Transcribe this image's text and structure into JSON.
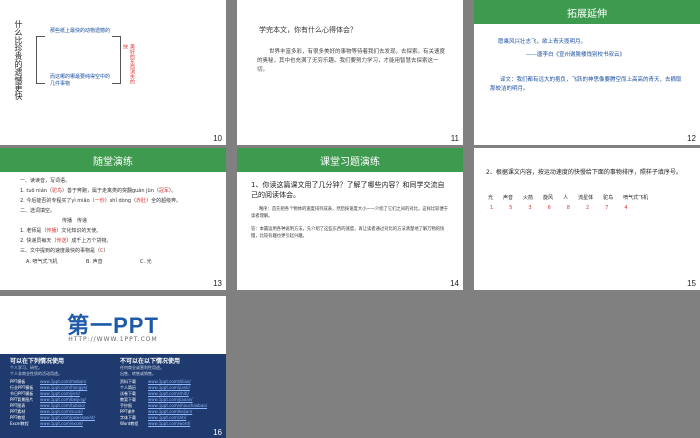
{
  "slides": {
    "s10": {
      "number": "10",
      "title": "什么比珍贵的遗憾更快",
      "branch1": "那些纸上最快的动物遗憾的",
      "branch2": "而这哪的哪最要纯得空中的几件事物",
      "side": "美好的东西消失的快"
    },
    "s11": {
      "number": "11",
      "title": "学完本文，你有什么心得体会？",
      "para": "世界丰富多彩，有很多美好的事物等待着我们去发现，去探索。有关速度的奥秘，其中也充满了无穷乐趣。我们要努力学习，才能用智慧去探索这一切。"
    },
    "s12": {
      "number": "12",
      "header": "拓展延伸",
      "quote1": "愿乘风兴壮志飞，欲上青天揽明月。",
      "quote2": "——唐李白《宣州谢朓楼饯别校书叔云》",
      "para": "译文：我们都有远大的抱负，飞跃的神思像要腾空而上高高的青天，去摘取那皎洁的明月。"
    },
    "s13": {
      "number": "13",
      "header": "随堂演练",
      "q1": "一、读读音，写词语。",
      "l1a": "1. tuō nián（",
      "l1b": "驼鸟",
      "l1c": "）善于奔跑，属于走禽类的",
      "l1d": "突翻guàn jūn（",
      "l1e": "冠军",
      "l1f": "）。",
      "l2a": "2. 今后能否的专程买了yì miǎo（",
      "l2b": "一秒",
      "l2c": "）shǐ dòng（",
      "l2d": "赤肚",
      "l2e": "）全的超级奔。",
      "q2": "二、选词填空。",
      "choices": "传播　传递",
      "s1a": "1. 老师是（",
      "s1b": "传播",
      "s1c": "）文化知识的天使。",
      "s2a": "2. 快递员每天（",
      "s2b": "传送",
      "s2c": "）成千上万个货物。",
      "q3a": "三、文中提到的速度最快的事物是（",
      "q3b": "C",
      "q3c": "）",
      "optA": "A. 喷气式飞机",
      "optB": "B. 声音",
      "optC": "C. 光"
    },
    "s14": {
      "number": "14",
      "header": "课堂习题演练",
      "question": "1、你读这篇课文用了几分钟？了解了哪些内容？和同学交流自己的阅读体会。",
      "para1": "略序：首先把各个物体的速度排列成表，然后按速度大小一一介绍了它们之间的对比，这样比较便于读者理解。",
      "para2": "答：本篇运用各种说明方法，先介绍了这些东西的速度，再让读者通过对比的方法清楚地了解万物的快慢，比较有趣也更引起兴趣。"
    },
    "s15": {
      "number": "15",
      "question": "2、根据课文内容，按运动速度的快慢给下面的事物排序，照样子填序号。",
      "items": [
        "光",
        "声音",
        "火箭",
        "旋风",
        "人",
        "流星体",
        "驼鸟",
        "喷气式飞机"
      ],
      "orders": [
        "1",
        "5",
        "3",
        "6",
        "8",
        "2",
        "7",
        "4"
      ]
    },
    "s16": {
      "number": "16",
      "logo": "第一PPT",
      "url": "HTTP://WWW.1PPT.COM",
      "left_title": "可以在下列情况使用",
      "left_sub1": "个人学习、研究。",
      "left_sub2": "个人非商业性质的活动用途。",
      "right_title": "不可以在以下情况使用",
      "right_sub1": "任何商业或营利性用途。",
      "right_sub2": "出售、转售或销售。",
      "left_cats": [
        "PPT模板",
        "行业PPT模板",
        "节日PPT模板",
        "PPT背景图片",
        "PPT图表",
        "PPT素材",
        "PPT教程",
        "Excel教程"
      ],
      "left_links": [
        "www.1ppt.com/moban/",
        "www.1ppt.com/hangye/",
        "www.1ppt.com/jieri/",
        "www.1ppt.com/beijing/",
        "www.1ppt.com/tubiao/",
        "www.1ppt.com/sucai/",
        "www.1ppt.com/powerpoint/",
        "www.1ppt.com/excel/"
      ],
      "right_cats": [
        "资料下载",
        "个人简历",
        "试卷下载",
        "教案下载",
        "手抄报",
        "PPT课件",
        "字体下载",
        "Word教程"
      ],
      "right_links": [
        "www.1ppt.com/ziliao/",
        "www.1ppt.com/jianli/",
        "www.1ppt.com/shiti/",
        "www.1ppt.com/jiaoan/",
        "www.1ppt.com/shouchaobao/",
        "www.1ppt.com/kejian/",
        "www.1ppt.com/ziti/",
        "www.1ppt.com/word/"
      ]
    }
  }
}
